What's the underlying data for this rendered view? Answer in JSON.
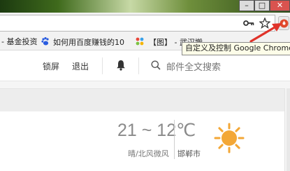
{
  "window": {
    "minimize": "–",
    "maximize": "□",
    "close": "✕"
  },
  "bookmarks": [
    {
      "label": "- 基金投资",
      "icon": "bookmark-icon"
    },
    {
      "label": "如何用百度赚钱的10",
      "icon": "baidu-paw-icon"
    },
    {
      "label": "【图】 - 武汉搬",
      "icon": "pinwheel-icon"
    }
  ],
  "tooltip": "自定义及控制 Google Chrome",
  "mail_header": {
    "lock_label": "锁屏",
    "logout_label": "退出",
    "search_placeholder": "邮件全文搜索"
  },
  "weather": {
    "temp_range": "21 ~ 12℃",
    "condition": "晴/北风微风",
    "city": "邯郸市",
    "icon": "sun-icon"
  },
  "colors": {
    "sun": "#f3a736",
    "arrow": "#e0332a",
    "menu_icon": "#e04a2c"
  }
}
